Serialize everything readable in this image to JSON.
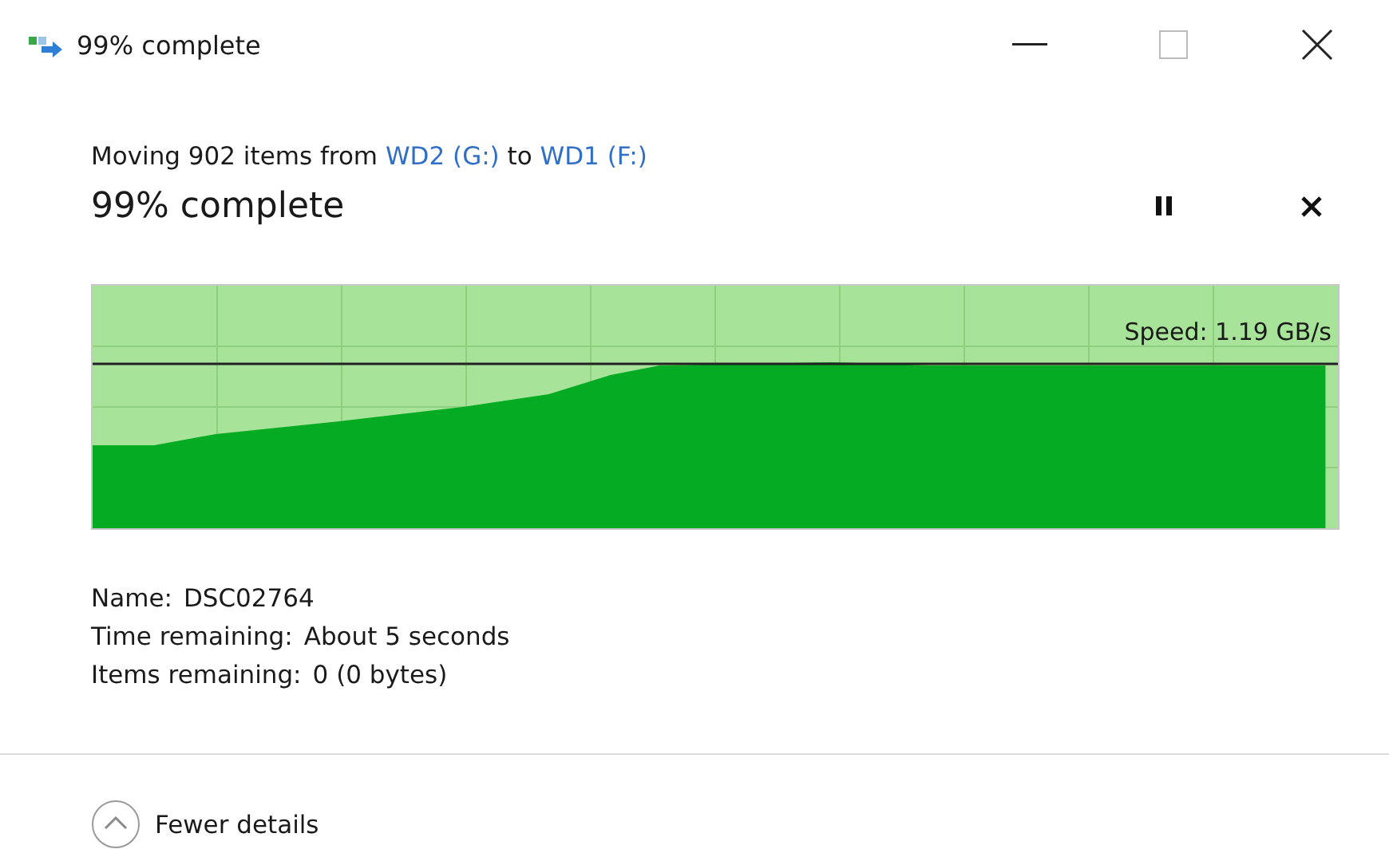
{
  "window": {
    "title": "99% complete"
  },
  "description": {
    "prefix": "Moving 902 items from",
    "source": "WD2 (G:)",
    "middle": "to",
    "destination": "WD1 (F:)"
  },
  "progress": {
    "heading": "99% complete",
    "level": 0.99,
    "speed": "Speed: 1.19 GB/s"
  },
  "details": [
    {
      "label": "Name:",
      "value": "DSC02764"
    },
    {
      "label": "Time remaining:",
      "value": "About 5 seconds"
    },
    {
      "label": "Items remaining:",
      "value": "0 (0 bytes)"
    }
  ],
  "toggle": {
    "label": "Fewer details",
    "expanded": true
  }
}
